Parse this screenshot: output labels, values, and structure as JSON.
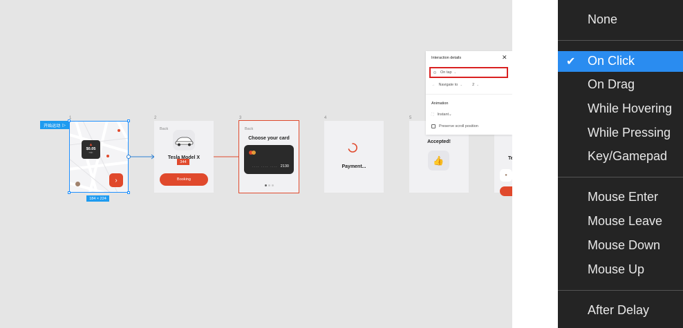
{
  "canvas": {
    "frame_numbers": [
      "1",
      "2",
      "3",
      "4",
      "5"
    ],
    "start_badge": "开始运动",
    "size_badge": "184 × 224",
    "map_price": "$0.05",
    "map_price_sub": "min",
    "frame2": {
      "back": "Back",
      "title": "Tesla Model X",
      "price_badge": "344",
      "button": "Booking"
    },
    "frame3": {
      "back": "Back",
      "title": "Choose your card",
      "card_dots": "···· ···· ····",
      "card_last": "2130"
    },
    "frame4": {
      "text": "Payment..."
    },
    "frame5": {
      "text": "Accepted!"
    },
    "frame6": {
      "partial_text": "Te"
    }
  },
  "panel": {
    "title": "Interaction details",
    "trigger": "On tap",
    "navigate_label": "Navigate to",
    "navigate_value": "2",
    "animation_title": "Animation",
    "animation_value": "Instant",
    "preserve_scroll": "Preserve scroll position"
  },
  "menu": {
    "items": [
      {
        "label": "None",
        "selected": false
      },
      {
        "label": "On Click",
        "selected": true
      },
      {
        "label": "On Drag",
        "selected": false
      },
      {
        "label": "While Hovering",
        "selected": false
      },
      {
        "label": "While Pressing",
        "selected": false
      },
      {
        "label": "Key/Gamepad",
        "selected": false
      },
      {
        "label": "Mouse Enter",
        "selected": false
      },
      {
        "label": "Mouse Leave",
        "selected": false
      },
      {
        "label": "Mouse Down",
        "selected": false
      },
      {
        "label": "Mouse Up",
        "selected": false
      },
      {
        "label": "After Delay",
        "selected": false
      }
    ]
  },
  "colors": {
    "accent_red": "#e0492c",
    "selection_blue": "#1e9bf0",
    "menu_highlight": "#2a8cf0",
    "highlight_outline": "#d92020"
  }
}
